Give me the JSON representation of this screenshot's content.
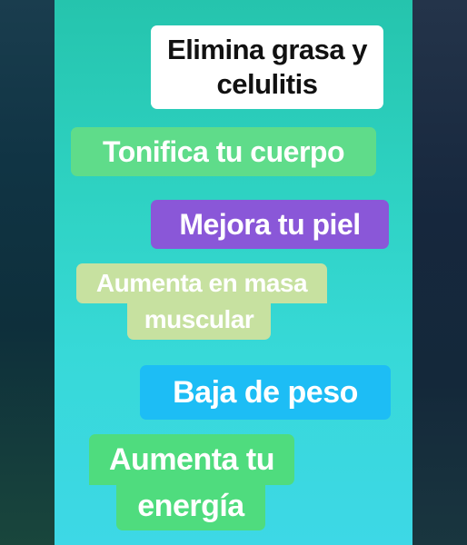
{
  "benefits": {
    "line1": "Elimina grasa y",
    "line1b": "celulitis",
    "line2": "Tonifica tu cuerpo",
    "line3": "Mejora tu piel",
    "line4a": "Aumenta en masa",
    "line4b": "muscular",
    "line5": "Baja de peso",
    "line6a": "Aumenta tu",
    "line6b": "energía"
  },
  "colors": {
    "panel_gradient_top": "#25c4ad",
    "panel_gradient_bottom": "#3dd8e6",
    "pill_white": "#ffffff",
    "pill_green": "#5fdc8a",
    "pill_purple": "#8a57d8",
    "pill_lightgreen": "#c7e1a0",
    "pill_blue": "#1dbdf5"
  }
}
